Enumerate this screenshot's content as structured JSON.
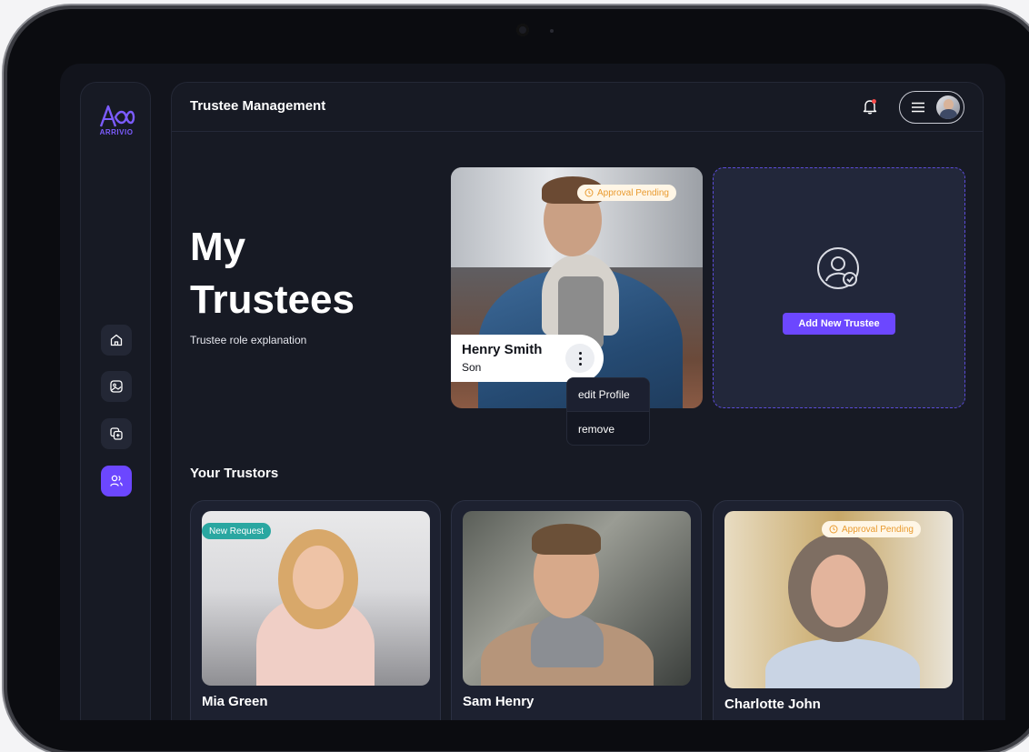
{
  "app": {
    "brand": "ARRIVIO",
    "page_title": "Trustee Management"
  },
  "sidebar": {
    "items": [
      {
        "name": "home",
        "icon": "home-icon",
        "active": false
      },
      {
        "name": "gallery",
        "icon": "image-icon",
        "active": false
      },
      {
        "name": "documents",
        "icon": "copy-icon",
        "active": false
      },
      {
        "name": "trustees",
        "icon": "users-icon",
        "active": true
      }
    ]
  },
  "hero": {
    "title_line1": "My",
    "title_line2": "Trustees",
    "subtitle": "Trustee role explanation"
  },
  "trustee": {
    "name": "Henry Smith",
    "role": "Son",
    "badge": "Approval Pending",
    "menu": [
      "edit Profile",
      "remove"
    ]
  },
  "add_trustee": {
    "button_label": "Add New Trustee"
  },
  "trustors_section": {
    "title": "Your Trustors",
    "cards": [
      {
        "name": "Mia Green",
        "badge": "New Request",
        "badge_type": "new"
      },
      {
        "name": "Sam Henry",
        "badge": "",
        "badge_type": ""
      },
      {
        "name": "Charlotte John",
        "badge": "Approval Pending",
        "badge_type": "pending"
      }
    ]
  },
  "colors": {
    "accent": "#6c47ff",
    "background": "#12141c",
    "pending_text": "#e99a2e",
    "new_badge": "#2aa7a1"
  }
}
